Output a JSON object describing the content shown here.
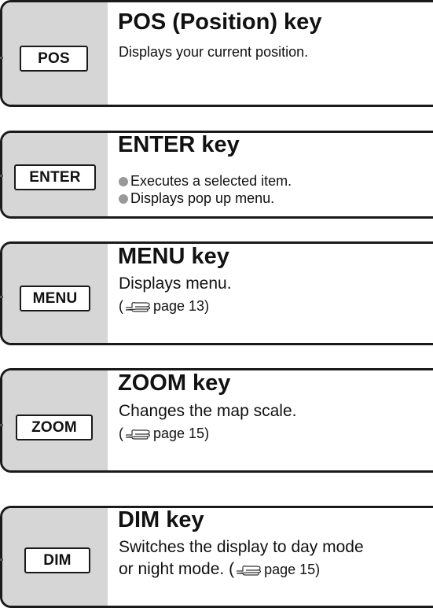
{
  "keys": [
    {
      "id": "pos",
      "button_label": "POS",
      "title": "POS (Position) key",
      "lines": [
        "Displays your current position."
      ]
    },
    {
      "id": "enter",
      "button_label": "ENTER",
      "title": "ENTER key",
      "bullets": [
        "Executes a selected item.",
        "Displays pop up menu."
      ]
    },
    {
      "id": "menu",
      "button_label": "MENU",
      "title": "MENU key",
      "text": "Displays menu.",
      "ref_open": "(",
      "ref_text": "page 13)"
    },
    {
      "id": "zoom",
      "button_label": "ZOOM",
      "title": "ZOOM key",
      "text": "Changes the map scale.",
      "ref_open": "(",
      "ref_text": "page 15)"
    },
    {
      "id": "dim",
      "button_label": "DIM",
      "title": "DIM key",
      "text": "Switches the display to day mode",
      "text2": "or night mode. (",
      "ref_text": "page 15)"
    }
  ],
  "icons": {
    "page_reference": "pointing-hand-icon"
  },
  "colors": {
    "panel_gray": "#d6d6d6",
    "border": "#1a1a1a",
    "bullet_gray": "#999999"
  }
}
